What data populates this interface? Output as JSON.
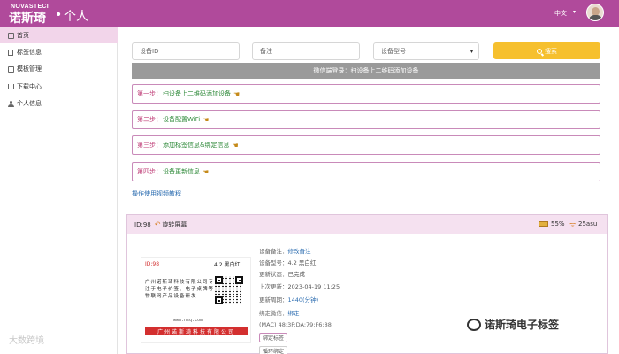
{
  "header": {
    "brand_en": "NOVASTECI",
    "brand_cn": "诺斯琦",
    "brand_separator": "•",
    "brand_section": "个人",
    "language": "中文",
    "bg_color": "#b04a9b"
  },
  "sidebar": {
    "items": [
      {
        "label": "首页",
        "icon": "home-icon",
        "active": true
      },
      {
        "label": "标签信息",
        "icon": "tag-icon",
        "active": false
      },
      {
        "label": "模板管理",
        "icon": "template-icon",
        "active": false
      },
      {
        "label": "下载中心",
        "icon": "download-icon",
        "active": false
      },
      {
        "label": "个人信息",
        "icon": "user-icon",
        "active": false
      }
    ]
  },
  "search": {
    "device_id_placeholder": "设备ID",
    "remark_placeholder": "备注",
    "model_select": "设备型号",
    "search_label": "搜索"
  },
  "wechat_bar": "微信端登录：扫设备上二维码添加设备",
  "steps": [
    {
      "prefix": "第一步：",
      "text": "扫设备上二维码添加设备"
    },
    {
      "prefix": "第二步：",
      "text": "设备配置WiFi"
    },
    {
      "prefix": "第三步：",
      "text": "添加标签信息&绑定信息"
    },
    {
      "prefix": "第四步：",
      "text": "设备更新信息"
    }
  ],
  "video_link": "操作使用视频教程",
  "device": {
    "id": "ID:98",
    "rotate_label": "旋转屏幕",
    "battery": "55%",
    "signal": "25asu",
    "tag_preview": {
      "id": "ID:98",
      "model": "4.2 黑白红",
      "company_text": "广州诺斯琦科技有限公司专注于电子价签、电子桌牌等物联网产品设备研发",
      "url": "www.nsq.com",
      "footer": "广州诺斯琦科技有限公司"
    },
    "info": {
      "remark_label": "设备备注：",
      "remark_value": "修改备注",
      "model_label": "设备型号：",
      "model_value": "4.2 黑白红",
      "status_label": "更新状态：",
      "status_value": "已完成",
      "last_update_label": "上次更新：",
      "last_update_value": "2023-04-19 11:25",
      "period_label": "更新周期：",
      "period_value": "1440(分钟)",
      "wechat_label": "绑定微信：",
      "wechat_value": "绑定",
      "mac": "(MAC) 48:3F:DA:79:F6:88",
      "bind_tag_button": "绑定标签",
      "cycle_bind_button": "循环绑定"
    }
  },
  "watermarks": {
    "left": "大数跨境",
    "right": "诺斯琦电子标签"
  }
}
